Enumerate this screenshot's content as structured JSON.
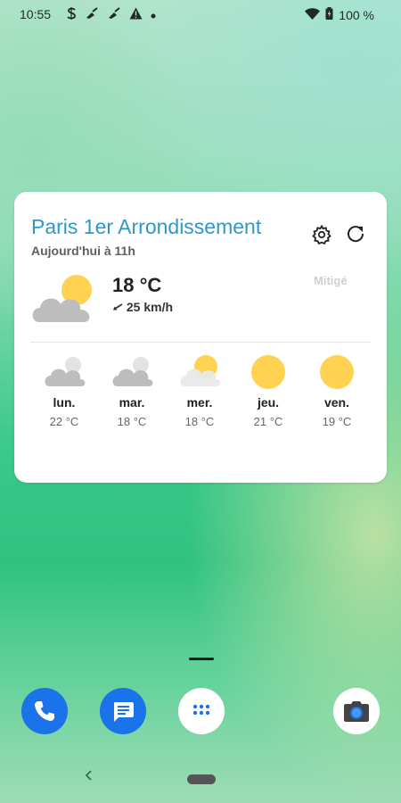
{
  "status_bar": {
    "time": "10:55",
    "battery": "100 %",
    "icons": [
      "s-icon",
      "broom-icon",
      "broom-icon",
      "warning-icon",
      "dot-icon",
      "wifi-icon",
      "battery-icon"
    ]
  },
  "widget": {
    "city": "Paris 1er Arrondissement",
    "updated": "Aujourd'hui à 11h",
    "current": {
      "temperature": "18 °C",
      "wind": "25 km/h",
      "condition": "Mitigé",
      "icon": "partly-cloudy-icon"
    },
    "forecast": [
      {
        "day": "lun.",
        "temp": "22 °C",
        "icon": "cloudy-icon"
      },
      {
        "day": "mar.",
        "temp": "18 °C",
        "icon": "cloudy-icon"
      },
      {
        "day": "mer.",
        "temp": "18 °C",
        "icon": "partly-sunny-icon"
      },
      {
        "day": "jeu.",
        "temp": "21 °C",
        "icon": "sun-icon"
      },
      {
        "day": "ven.",
        "temp": "19 °C",
        "icon": "sun-icon"
      }
    ]
  },
  "dock": {
    "apps": [
      "phone-icon",
      "messages-icon",
      "app-drawer-icon",
      "camera-icon"
    ]
  },
  "colors": {
    "accent": "#2f98c9",
    "sun": "#ffd351",
    "cloud": "#bdbdbd",
    "dock_blue": "#1a73e8"
  }
}
